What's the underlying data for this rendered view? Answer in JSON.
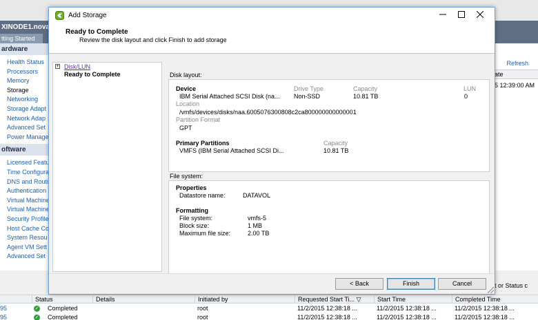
{
  "background": {
    "host_name": "XINODE1.nova",
    "host_tab": "tting Started",
    "hardware_header": "ardware",
    "hardware_items": [
      "Health Status",
      "Processors",
      "Memory",
      "Storage",
      "Networking",
      "Storage Adapt",
      "Network Adap",
      "Advanced Set",
      "Power Manage"
    ],
    "software_header": "oftware",
    "software_items": [
      "Licensed Featu",
      "Time Configura",
      "DNS and Routi",
      "Authentication",
      "Virtual Machine",
      "Virtual Machine",
      "Security Profile",
      "Host Cache Co",
      "System Resou",
      "Agent VM Sett",
      "Advanced Set"
    ],
    "refresh_label": "Refresh",
    "right_col_header": "ate",
    "right_date": "5 12:39:00 AM",
    "status_filter_text": "get or Status c"
  },
  "tasks": {
    "columns": [
      "Status",
      "Details",
      "Initiated by",
      "Requested Start Ti...",
      "Start Time",
      "Completed Time"
    ],
    "rows": [
      {
        "id": "95",
        "status": "Completed",
        "details": "",
        "initiated_by": "root",
        "requested": "11/2/2015 12:38:18 ...",
        "start": "11/2/2015 12:38:18 ...",
        "completed": "11/2/2015 12:38:18 ..."
      },
      {
        "id": "95",
        "status": "Completed",
        "details": "",
        "initiated_by": "root",
        "requested": "11/2/2015 12:38:18 ...",
        "start": "11/2/2015 12:38:18 ...",
        "completed": "11/2/2015 12:38:18 ..."
      }
    ]
  },
  "dialog": {
    "title": "Add Storage",
    "step_title": "Ready to Complete",
    "step_subtitle": "Review the disk layout and click Finish to add storage",
    "nav": {
      "link": "Disk/LUN",
      "current": "Ready to Complete"
    },
    "disk_layout": {
      "label": "Disk layout:",
      "device_header": "Device",
      "drive_type_header": "Drive Type",
      "capacity_header": "Capacity",
      "lun_header": "LUN",
      "device": "IBM Serial Attached SCSI Disk (na...",
      "drive_type": "Non-SSD",
      "capacity": "10.81 TB",
      "lun": "0",
      "location_label": "Location",
      "location": "/vmfs/devices/disks/naa.6005076300808c2ca800000000000001",
      "partition_format_label": "Partition Format",
      "partition_format": "GPT",
      "primary_partitions_header": "Primary Partitions",
      "partition_capacity_header": "Capacity",
      "partition": "VMFS (IBM Serial Attached SCSI Di...",
      "partition_capacity": "10.81 TB"
    },
    "file_system": {
      "label": "File system:",
      "properties_header": "Properties",
      "datastore_name_label": "Datastore name:",
      "datastore_name": "DATAVOL",
      "formatting_header": "Formatting",
      "fs_label": "File system:",
      "fs_value": "vmfs-5",
      "block_size_label": "Block size:",
      "block_size": "1 MB",
      "max_file_size_label": "Maximum file size:",
      "max_file_size": "2.00 TB"
    },
    "buttons": {
      "back": "< Back",
      "finish": "Finish",
      "cancel": "Cancel"
    }
  }
}
